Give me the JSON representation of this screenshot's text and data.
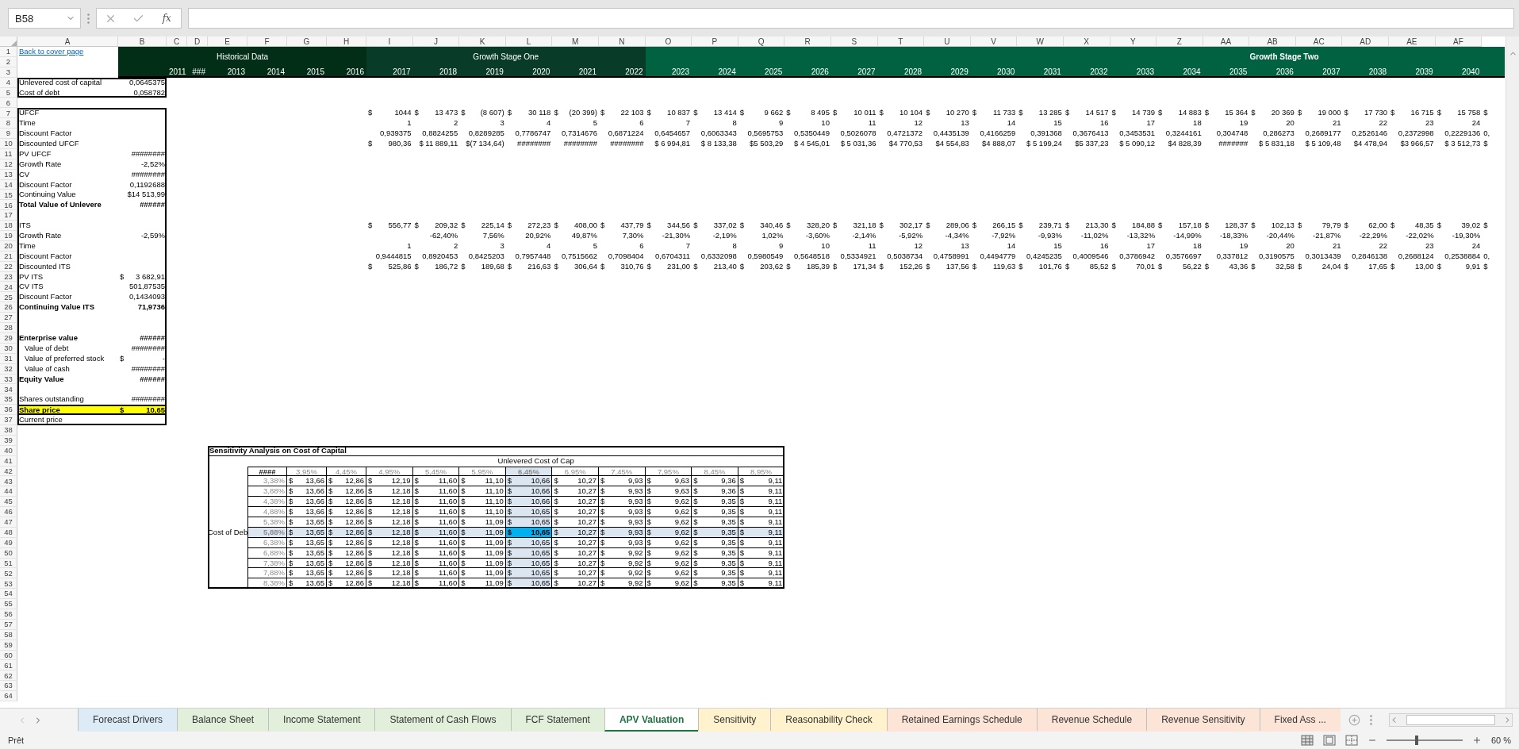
{
  "formula_bar": {
    "name_box": "B58",
    "function_label": "fx"
  },
  "column_headers": [
    "A",
    "B",
    "C",
    "D",
    "E",
    "F",
    "G",
    "H",
    "I",
    "J",
    "K",
    "L",
    "M",
    "N",
    "O",
    "P",
    "Q",
    "R",
    "S",
    "T",
    "U",
    "V",
    "W",
    "X",
    "Y",
    "Z",
    "AA",
    "AB",
    "AC",
    "AD",
    "AE",
    "AF"
  ],
  "row_headers": [
    "1",
    "2",
    "3",
    "4",
    "5",
    "6",
    "7",
    "8",
    "9",
    "10",
    "11",
    "12",
    "13",
    "14",
    "15",
    "16",
    "17",
    "18",
    "19",
    "20",
    "21",
    "22",
    "23",
    "24",
    "25",
    "26",
    "27",
    "28",
    "29",
    "30",
    "31",
    "32",
    "33",
    "34",
    "35",
    "36",
    "37",
    "38",
    "39",
    "40",
    "41",
    "42",
    "43",
    "44",
    "45",
    "46",
    "47",
    "48",
    "49",
    "50",
    "51",
    "52",
    "53",
    "54",
    "55",
    "56",
    "57",
    "58",
    "59",
    "60",
    "61",
    "62",
    "63",
    "64"
  ],
  "cover_link": "Back to cover page",
  "header_bands": [
    {
      "label": "Historical Data",
      "color": "#022e18",
      "bold": false,
      "years": [
        "2011",
        "###",
        "2013",
        "2014",
        "2015",
        "2016"
      ]
    },
    {
      "label": "Growth Stage One",
      "color": "#083c28",
      "bold": false,
      "years": [
        "2017",
        "2018",
        "2019",
        "2020",
        "2021",
        "2022"
      ]
    },
    {
      "label": "Growth Stage Two",
      "color": "#006241",
      "bold": true,
      "years": [
        "2023",
        "2024",
        "2025",
        "2026",
        "2027",
        "2028",
        "2029",
        "2030",
        "2031",
        "2032",
        "2033",
        "2034",
        "2035",
        "2036",
        "2037",
        "2038",
        "2039",
        "2040"
      ]
    }
  ],
  "assumptions": [
    {
      "label": "Unlevered cost of capital",
      "value": "0,0645375"
    },
    {
      "label": "Cost of debt",
      "value": "0,058782"
    }
  ],
  "model": [
    {
      "kind": "line",
      "label": "UFCF",
      "values": [
        [
          "$",
          "1044"
        ],
        [
          "$",
          "13 473"
        ],
        [
          "$",
          "(8 607)"
        ],
        [
          "$",
          "30 118"
        ],
        [
          "$",
          "(20 399)"
        ],
        [
          "$",
          "22 103"
        ],
        [
          "$",
          "10 837"
        ],
        [
          "$",
          "13 414"
        ],
        [
          "$",
          "9 662"
        ],
        [
          "$",
          "8 495"
        ],
        [
          "$",
          "10 011"
        ],
        [
          "$",
          "10 104"
        ],
        [
          "$",
          "10 270"
        ],
        [
          "$",
          "11 733"
        ],
        [
          "$",
          "13 285"
        ],
        [
          "$",
          "14 517"
        ],
        [
          "$",
          "14 739"
        ],
        [
          "$",
          "14 883"
        ],
        [
          "$",
          "15 364"
        ],
        [
          "$",
          "20 369"
        ],
        [
          "$",
          "19 000"
        ],
        [
          "$",
          "17 730"
        ],
        [
          "$",
          "16 715"
        ],
        [
          "$",
          "15 758"
        ],
        [
          "$"
        ]
      ]
    },
    {
      "kind": "line",
      "label": "Time",
      "values": [
        "1",
        "2",
        "3",
        "4",
        "5",
        "6",
        "7",
        "8",
        "9",
        "10",
        "11",
        "12",
        "13",
        "14",
        "15",
        "16",
        "17",
        "18",
        "19",
        "20",
        "21",
        "22",
        "23",
        "24"
      ]
    },
    {
      "kind": "line",
      "label": "Discount Factor",
      "values": [
        "0,939375",
        "0,8824255",
        "0,8289285",
        "0,7786747",
        "0,7314676",
        "0,6871224",
        "0,6454657",
        "0,6063343",
        "0,5695753",
        "0,5350449",
        "0,5026078",
        "0,4721372",
        "0,4435139",
        "0,4166259",
        "0,391368",
        "0,3676413",
        "0,3453531",
        "0,3244161",
        "0,304748",
        "0,286273",
        "0,2689177",
        "0,2526146",
        "0,2372998",
        "0,2229136",
        "0,"
      ]
    },
    {
      "kind": "line",
      "label": "Discounted UFCF",
      "values": [
        [
          "$",
          "980,36"
        ],
        "$ 11 889,11",
        "$(7 134,64)",
        "########",
        "########",
        "########",
        "$ 6 994,81",
        "$ 8 133,38",
        "$5 503,29",
        "$ 4 545,01",
        "$ 5 031,36",
        "$4 770,53",
        "$4 554,83",
        "$4 888,07",
        "$ 5 199,24",
        "$5 337,23",
        "$ 5 090,12",
        "$4 828,39",
        "#######",
        "$ 5 831,18",
        "$ 5 109,48",
        "$4 478,94",
        "$3 966,57",
        "$ 3 512,73",
        [
          "$"
        ]
      ]
    },
    {
      "kind": "line",
      "label": "PV UFCF",
      "value": "########"
    },
    {
      "kind": "line",
      "label": "Growth Rate",
      "value": "-2,52%"
    },
    {
      "kind": "line",
      "label": "CV",
      "value": "########"
    },
    {
      "kind": "line",
      "label": "Discount Factor",
      "value": "0,1192688"
    },
    {
      "kind": "line",
      "label": "Continuing Value",
      "value": "$14 513,99"
    },
    {
      "kind": "total",
      "label": "Total Value of Unlevere",
      "value": "######"
    },
    {
      "kind": "blank"
    },
    {
      "kind": "line",
      "label": "ITS",
      "values": [
        [
          "$",
          "556,77"
        ],
        [
          "$",
          "209,32"
        ],
        [
          "$",
          "225,14"
        ],
        [
          "$",
          "272,23"
        ],
        [
          "$",
          "408,00"
        ],
        [
          "$",
          "437,79"
        ],
        [
          "$",
          "344,56"
        ],
        [
          "$",
          "337,02"
        ],
        [
          "$",
          "340,46"
        ],
        [
          "$",
          "328,20"
        ],
        [
          "$",
          "321,18"
        ],
        [
          "$",
          "302,17"
        ],
        [
          "$",
          "289,06"
        ],
        [
          "$",
          "266,15"
        ],
        [
          "$",
          "239,71"
        ],
        [
          "$",
          "213,30"
        ],
        [
          "$",
          "184,88"
        ],
        [
          "$",
          "157,18"
        ],
        [
          "$",
          "128,37"
        ],
        [
          "$",
          "102,13"
        ],
        [
          "$",
          "79,79"
        ],
        [
          "$",
          "62,00"
        ],
        [
          "$",
          "48,35"
        ],
        [
          "$",
          "39,02"
        ],
        [
          "$"
        ]
      ]
    },
    {
      "kind": "growth",
      "label": "Growth Rate",
      "value": "-2,59%",
      "values": [
        "-62,40%",
        "7,56%",
        "20,92%",
        "49,87%",
        "7,30%",
        "-21,30%",
        "-2,19%",
        "1,02%",
        "-3,60%",
        "-2,14%",
        "-5,92%",
        "-4,34%",
        "-7,92%",
        "-9,93%",
        "-11,02%",
        "-13,32%",
        "-14,99%",
        "-18,33%",
        "-20,44%",
        "-21,87%",
        "-22,29%",
        "-22,02%",
        "-19,30%"
      ]
    },
    {
      "kind": "line",
      "label": "Time",
      "values": [
        "1",
        "2",
        "3",
        "4",
        "5",
        "6",
        "7",
        "8",
        "9",
        "10",
        "11",
        "12",
        "13",
        "14",
        "15",
        "16",
        "17",
        "18",
        "19",
        "20",
        "21",
        "22",
        "23",
        "24"
      ]
    },
    {
      "kind": "line",
      "label": "Discount Factor",
      "values": [
        "0,9444815",
        "0,8920453",
        "0,8425203",
        "0,7957448",
        "0,7515662",
        "0,7098404",
        "0,6704311",
        "0,6332098",
        "0,5980549",
        "0,5648518",
        "0,5334921",
        "0,5038734",
        "0,4758991",
        "0,4494779",
        "0,4245235",
        "0,4009546",
        "0,3786942",
        "0,3576697",
        "0,337812",
        "0,3190575",
        "0,3013439",
        "0,2846138",
        "0,2688124",
        "0,2538884",
        "0,"
      ]
    },
    {
      "kind": "line",
      "label": "Discounted ITS",
      "values": [
        [
          "$",
          "525,86"
        ],
        [
          "$",
          "186,72"
        ],
        [
          "$",
          "189,68"
        ],
        [
          "$",
          "216,63"
        ],
        [
          "$",
          "306,64"
        ],
        [
          "$",
          "310,76"
        ],
        [
          "$",
          "231,00"
        ],
        [
          "$",
          "213,40"
        ],
        [
          "$",
          "203,62"
        ],
        [
          "$",
          "185,39"
        ],
        [
          "$",
          "171,34"
        ],
        [
          "$",
          "152,26"
        ],
        [
          "$",
          "137,56"
        ],
        [
          "$",
          "119,63"
        ],
        [
          "$",
          "101,76"
        ],
        [
          "$",
          "85,52"
        ],
        [
          "$",
          "70,01"
        ],
        [
          "$",
          "56,22"
        ],
        [
          "$",
          "43,36"
        ],
        [
          "$",
          "32,58"
        ],
        [
          "$",
          "24,04"
        ],
        [
          "$",
          "17,65"
        ],
        [
          "$",
          "13,00"
        ],
        [
          "$",
          "9,91"
        ],
        [
          "$"
        ]
      ]
    },
    {
      "kind": "line",
      "label": "PV ITS",
      "value": [
        "$",
        "3 682,91"
      ]
    },
    {
      "kind": "line",
      "label": "CV ITS",
      "value": "501,87535"
    },
    {
      "kind": "line",
      "label": "Discount Factor",
      "value": "0,1434093"
    },
    {
      "kind": "total",
      "label": "Continuing Value ITS",
      "value": "71,9736"
    },
    {
      "kind": "blank"
    },
    {
      "kind": "blank"
    },
    {
      "kind": "total",
      "label": "Enterprise value",
      "value": "######"
    },
    {
      "kind": "sub",
      "label": "Value of debt",
      "value": "########"
    },
    {
      "kind": "sub",
      "label": "Value of preferred stock",
      "value": [
        "$",
        "-"
      ]
    },
    {
      "kind": "sub",
      "label": "Value of cash",
      "value": "########"
    },
    {
      "kind": "total",
      "label": "Equity Value",
      "value": "######"
    },
    {
      "kind": "blank"
    },
    {
      "kind": "line",
      "label": "Shares outstanding",
      "value": "########"
    },
    {
      "kind": "highlight",
      "label": "Share price",
      "value": [
        "$",
        "10,65"
      ]
    },
    {
      "kind": "line",
      "label": "Current price"
    }
  ],
  "sensitivity": {
    "title": "Sensitivity Analysis on Cost of Capital",
    "column_axis": "Unlevered Cost of Cap",
    "row_axis": "Cost of Deb",
    "corner": "####",
    "columns": [
      {
        "label": "3,95%",
        "selected": false
      },
      {
        "label": "4,45%",
        "selected": false
      },
      {
        "label": "4,95%",
        "selected": false
      },
      {
        "label": "5,45%",
        "selected": false
      },
      {
        "label": "5,95%",
        "selected": false
      },
      {
        "label": "6,45%",
        "selected": true
      },
      {
        "label": "6,95%",
        "selected": false
      },
      {
        "label": "7,45%",
        "selected": false
      },
      {
        "label": "7,95%",
        "selected": false
      },
      {
        "label": "8,45%",
        "selected": false
      },
      {
        "label": "8,95%",
        "selected": false
      }
    ],
    "rows": [
      {
        "label": "3,38%",
        "selected": false,
        "cells": [
          [
            "$",
            "13,66"
          ],
          [
            "$",
            "12,86"
          ],
          [
            "$",
            "12,19"
          ],
          [
            "$",
            "11,60"
          ],
          [
            "$",
            "11,10"
          ],
          [
            "$",
            "10,66"
          ],
          [
            "$",
            "10,27"
          ],
          [
            "$",
            "9,93"
          ],
          [
            "$",
            "9,63"
          ],
          [
            "$",
            "9,36"
          ],
          [
            "$",
            "9,11"
          ]
        ]
      },
      {
        "label": "3,88%",
        "selected": false,
        "cells": [
          [
            "$",
            "13,66"
          ],
          [
            "$",
            "12,86"
          ],
          [
            "$",
            "12,18"
          ],
          [
            "$",
            "11,60"
          ],
          [
            "$",
            "11,10"
          ],
          [
            "$",
            "10,66"
          ],
          [
            "$",
            "10,27"
          ],
          [
            "$",
            "9,93"
          ],
          [
            "$",
            "9,63"
          ],
          [
            "$",
            "9,36"
          ],
          [
            "$",
            "9,11"
          ]
        ]
      },
      {
        "label": "4,38%",
        "selected": false,
        "cells": [
          [
            "$",
            "13,66"
          ],
          [
            "$",
            "12,86"
          ],
          [
            "$",
            "12,18"
          ],
          [
            "$",
            "11,60"
          ],
          [
            "$",
            "11,10"
          ],
          [
            "$",
            "10,66"
          ],
          [
            "$",
            "10,27"
          ],
          [
            "$",
            "9,93"
          ],
          [
            "$",
            "9,62"
          ],
          [
            "$",
            "9,35"
          ],
          [
            "$",
            "9,11"
          ]
        ]
      },
      {
        "label": "4,88%",
        "selected": false,
        "cells": [
          [
            "$",
            "13,66"
          ],
          [
            "$",
            "12,86"
          ],
          [
            "$",
            "12,18"
          ],
          [
            "$",
            "11,60"
          ],
          [
            "$",
            "11,10"
          ],
          [
            "$",
            "10,65"
          ],
          [
            "$",
            "10,27"
          ],
          [
            "$",
            "9,93"
          ],
          [
            "$",
            "9,62"
          ],
          [
            "$",
            "9,35"
          ],
          [
            "$",
            "9,11"
          ]
        ]
      },
      {
        "label": "5,38%",
        "selected": false,
        "cells": [
          [
            "$",
            "13,65"
          ],
          [
            "$",
            "12,86"
          ],
          [
            "$",
            "12,18"
          ],
          [
            "$",
            "11,60"
          ],
          [
            "$",
            "11,09"
          ],
          [
            "$",
            "10,65"
          ],
          [
            "$",
            "10,27"
          ],
          [
            "$",
            "9,93"
          ],
          [
            "$",
            "9,62"
          ],
          [
            "$",
            "9,35"
          ],
          [
            "$",
            "9,11"
          ]
        ]
      },
      {
        "label": "5,88%",
        "selected": true,
        "cells": [
          [
            "$",
            "13,65"
          ],
          [
            "$",
            "12,86"
          ],
          [
            "$",
            "12,18"
          ],
          [
            "$",
            "11,60"
          ],
          [
            "$",
            "11,09"
          ],
          [
            "$",
            "10,65"
          ],
          [
            "$",
            "10,27"
          ],
          [
            "$",
            "9,93"
          ],
          [
            "$",
            "9,62"
          ],
          [
            "$",
            "9,35"
          ],
          [
            "$",
            "9,11"
          ]
        ]
      },
      {
        "label": "6,38%",
        "selected": false,
        "cells": [
          [
            "$",
            "13,65"
          ],
          [
            "$",
            "12,86"
          ],
          [
            "$",
            "12,18"
          ],
          [
            "$",
            "11,60"
          ],
          [
            "$",
            "11,09"
          ],
          [
            "$",
            "10,65"
          ],
          [
            "$",
            "10,27"
          ],
          [
            "$",
            "9,93"
          ],
          [
            "$",
            "9,62"
          ],
          [
            "$",
            "9,35"
          ],
          [
            "$",
            "9,11"
          ]
        ]
      },
      {
        "label": "6,88%",
        "selected": false,
        "cells": [
          [
            "$",
            "13,65"
          ],
          [
            "$",
            "12,86"
          ],
          [
            "$",
            "12,18"
          ],
          [
            "$",
            "11,60"
          ],
          [
            "$",
            "11,09"
          ],
          [
            "$",
            "10,65"
          ],
          [
            "$",
            "10,27"
          ],
          [
            "$",
            "9,92"
          ],
          [
            "$",
            "9,62"
          ],
          [
            "$",
            "9,35"
          ],
          [
            "$",
            "9,11"
          ]
        ]
      },
      {
        "label": "7,38%",
        "selected": false,
        "cells": [
          [
            "$",
            "13,65"
          ],
          [
            "$",
            "12,86"
          ],
          [
            "$",
            "12,18"
          ],
          [
            "$",
            "11,60"
          ],
          [
            "$",
            "11,09"
          ],
          [
            "$",
            "10,65"
          ],
          [
            "$",
            "10,27"
          ],
          [
            "$",
            "9,92"
          ],
          [
            "$",
            "9,62"
          ],
          [
            "$",
            "9,35"
          ],
          [
            "$",
            "9,11"
          ]
        ]
      },
      {
        "label": "7,88%",
        "selected": false,
        "cells": [
          [
            "$",
            "13,65"
          ],
          [
            "$",
            "12,86"
          ],
          [
            "$",
            "12,18"
          ],
          [
            "$",
            "11,60"
          ],
          [
            "$",
            "11,09"
          ],
          [
            "$",
            "10,65"
          ],
          [
            "$",
            "10,27"
          ],
          [
            "$",
            "9,92"
          ],
          [
            "$",
            "9,62"
          ],
          [
            "$",
            "9,35"
          ],
          [
            "$",
            "9,11"
          ]
        ]
      },
      {
        "label": "8,38%",
        "selected": false,
        "cells": [
          [
            "$",
            "13,65"
          ],
          [
            "$",
            "12,86"
          ],
          [
            "$",
            "12,18"
          ],
          [
            "$",
            "11,60"
          ],
          [
            "$",
            "11,09"
          ],
          [
            "$",
            "10,65"
          ],
          [
            "$",
            "10,27"
          ],
          [
            "$",
            "9,92"
          ],
          [
            "$",
            "9,62"
          ],
          [
            "$",
            "9,35"
          ],
          [
            "$",
            "9,11"
          ]
        ]
      }
    ]
  },
  "sheet_tabs": [
    {
      "label": "Forecast Drivers",
      "color": "#ddebf7",
      "selected": false
    },
    {
      "label": "Balance Sheet",
      "color": "#e2efda",
      "selected": false
    },
    {
      "label": "Income Statement",
      "color": "#e2efda",
      "selected": false
    },
    {
      "label": "Statement of Cash Flows",
      "color": "#e2efda",
      "selected": false
    },
    {
      "label": "FCF Statement",
      "color": "#e2efda",
      "selected": false
    },
    {
      "label": "APV Valuation",
      "selected": true
    },
    {
      "label": "Sensitivity",
      "color": "#fff2cc",
      "selected": false
    },
    {
      "label": "Reasonability Check",
      "color": "#fff2cc",
      "selected": false
    },
    {
      "label": "Retained Earnings Schedule",
      "color": "#fce4d6",
      "selected": false
    },
    {
      "label": "Revenue Schedule",
      "color": "#fce4d6",
      "selected": false
    },
    {
      "label": "Revenue Sensitivity",
      "color": "#fce4d6",
      "selected": false
    },
    {
      "label": "Fixed Ass ...",
      "color": "#fce4d6",
      "selected": false
    }
  ],
  "status_bar": {
    "status": "Prêt",
    "zoom": {
      "level": 0.4,
      "reading": "60 %"
    }
  }
}
